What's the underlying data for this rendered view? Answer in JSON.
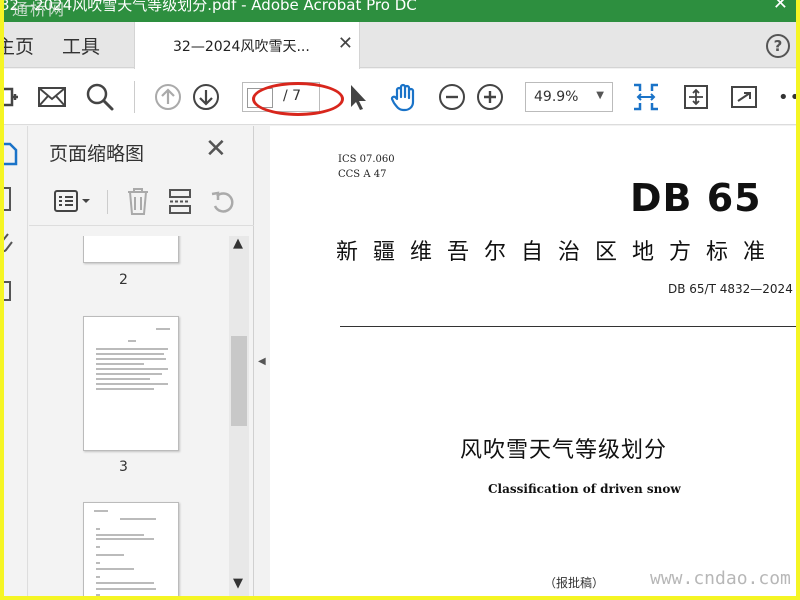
{
  "window": {
    "title": "32—2024风吹雪天气等级划分.pdf - Adobe Acrobat Pro DC",
    "watermark": "通桥网"
  },
  "tabs": {
    "home": "主页",
    "tools": "工具",
    "document": "32—2024风吹雪天..."
  },
  "toolbar": {
    "current_page": "",
    "total_pages": "/ 7",
    "zoom": "49.9%"
  },
  "thumbnails": {
    "title": "页面缩略图",
    "pages": [
      {
        "label": "2"
      },
      {
        "label": "3"
      }
    ]
  },
  "document": {
    "ics": "ICS  07.060",
    "ccs": "CCS  A  47",
    "db": "DB 65",
    "standard_name": "新疆维吾尔自治区地方标准",
    "code": "DB 65/T  4832—2024",
    "title": "风吹雪天气等级划分",
    "subtitle": "Classification of driven snow",
    "draft": "（报批稿）"
  },
  "watermark_bottom": "www.cndao.com",
  "colors": {
    "titlebar": "#2d8f3f",
    "accent_blue": "#1a73c8",
    "annotation_red": "#d8261c",
    "border_yellow": "#f5f524"
  }
}
